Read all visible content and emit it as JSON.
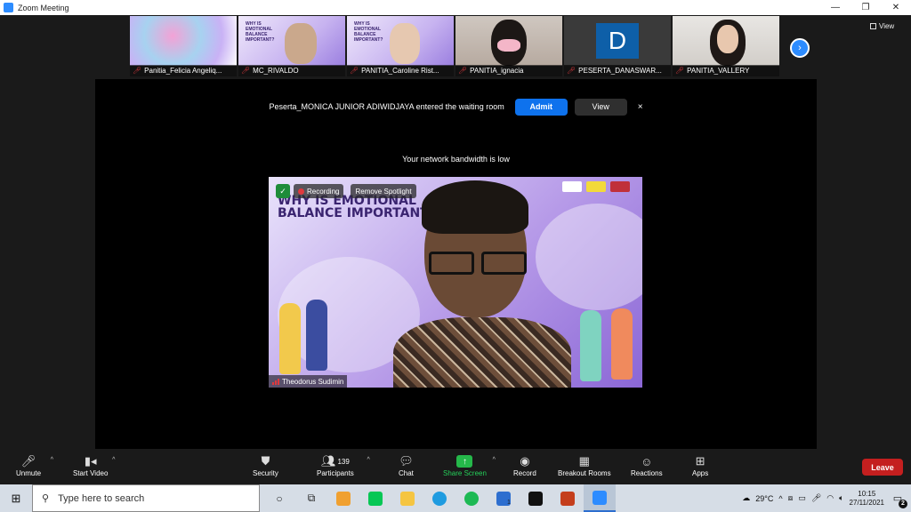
{
  "window": {
    "title": "Zoom Meeting",
    "minimize_glyph": "—",
    "restore_glyph": "❐",
    "close_glyph": "✕"
  },
  "thumbnails": [
    {
      "name": "Panitia_Felicia Angeliq...",
      "kind": "swirl",
      "icon": "muted-mic-icon"
    },
    {
      "name": "MC_RIVALDO",
      "kind": "slide",
      "icon": "muted-mic-icon"
    },
    {
      "name": "PANITIA_Caroline Rist...",
      "kind": "slide",
      "icon": "muted-mic-icon"
    },
    {
      "name": "PANITIA_ignacia",
      "kind": "face",
      "icon": "muted-mic-icon"
    },
    {
      "name": "PESERTA_DANASWAR...",
      "kind": "avatar",
      "avatar_letter": "D",
      "icon": "muted-mic-icon"
    },
    {
      "name": "PANITIA_VALLERY",
      "kind": "face",
      "icon": "muted-mic-icon"
    }
  ],
  "slide_thumb_text": "WHY IS EMOTIONAL BALANCE IMPORTANT?",
  "next_page_glyph": "›",
  "view_label": "View",
  "waiting_room": {
    "message": "Peserta_MONICA JUNIOR ADIWIDJAYA entered the waiting room",
    "admit_label": "Admit",
    "view_label": "View",
    "close_glyph": "×"
  },
  "bandwidth_notice": "Your network bandwidth is low",
  "main_video": {
    "slide_title_line1": "WHY IS EMOTIONAL",
    "slide_title_line2": "BALANCE IMPORTANT",
    "recording_label": "Recording",
    "spotlight_label": "Remove Spotlight",
    "speaker_name": "Theodorus Sudimin"
  },
  "toolbar": {
    "unmute": "Unmute",
    "start_video": "Start Video",
    "security": "Security",
    "participants": "Participants",
    "participants_count": "139",
    "chat": "Chat",
    "share_screen": "Share Screen",
    "record": "Record",
    "breakout_rooms": "Breakout Rooms",
    "reactions": "Reactions",
    "apps": "Apps",
    "leave": "Leave"
  },
  "taskbar": {
    "search_placeholder": "Type here to search",
    "weather": "29°C",
    "time": "10:15",
    "date": "27/11/2021",
    "notifications": "2",
    "mail_badge": "1"
  },
  "colors": {
    "accent_blue": "#2D8CFF",
    "admit_blue": "#0e72ed",
    "leave_red": "#c41f1f",
    "share_green": "#25b84a"
  }
}
